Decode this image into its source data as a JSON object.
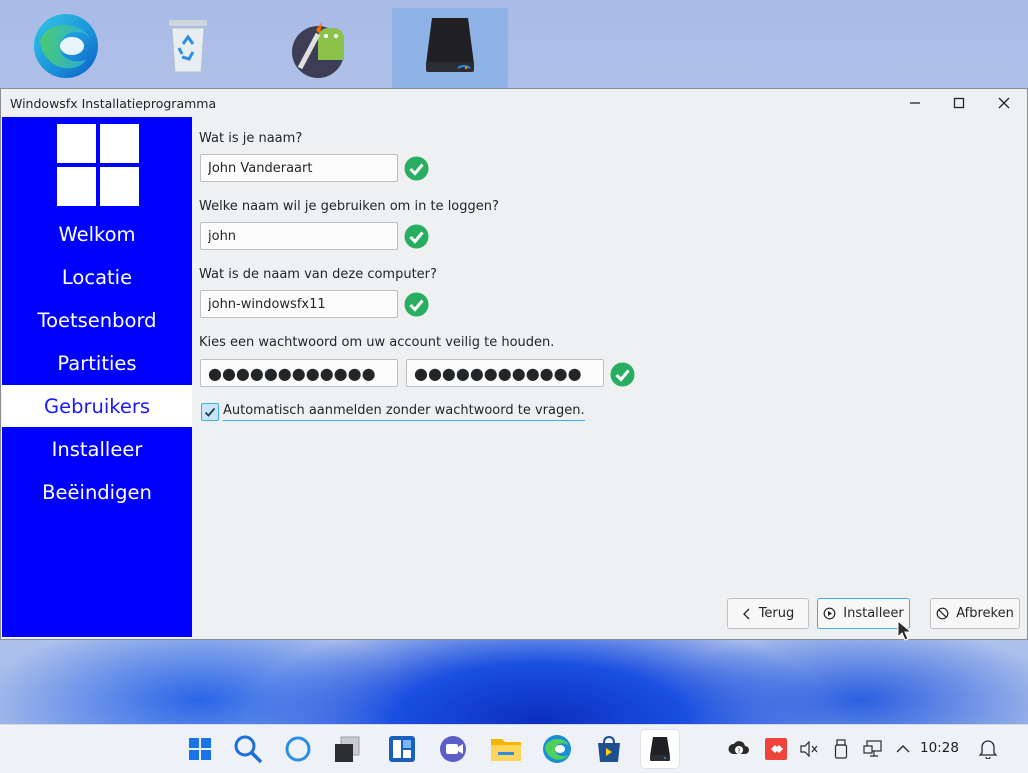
{
  "window": {
    "title": "Windowsfx Installatieprogramma"
  },
  "sidebar": {
    "items": [
      {
        "label": "Welkom",
        "active": false
      },
      {
        "label": "Locatie",
        "active": false
      },
      {
        "label": "Toetsenbord",
        "active": false
      },
      {
        "label": "Partities",
        "active": false
      },
      {
        "label": "Gebruikers",
        "active": true
      },
      {
        "label": "Installeer",
        "active": false
      },
      {
        "label": "Beëindigen",
        "active": false
      }
    ]
  },
  "form": {
    "name_question": "Wat is je naam?",
    "name_value": "John Vanderaart",
    "login_question": "Welke naam wil je gebruiken om in te loggen?",
    "login_value": "john",
    "computer_question": "Wat is de naam van deze computer?",
    "computer_value": "john-windowsfx11",
    "password_question": "Kies een wachtwoord om uw account veilig te houden.",
    "password_mask": "●●●●●●●●●●●●",
    "password_confirm_mask": "●●●●●●●●●●●●",
    "autologin_label": "Automatisch aanmelden zonder wachtwoord te vragen.",
    "autologin_checked": true
  },
  "buttons": {
    "back": "Terug",
    "install": "Installeer",
    "cancel": "Afbreken"
  },
  "taskbar": {
    "clock": "10:28"
  },
  "colors": {
    "sidebar_bg": "#0000ff",
    "accent": "#3daee9",
    "ok_green": "#27ae60"
  }
}
